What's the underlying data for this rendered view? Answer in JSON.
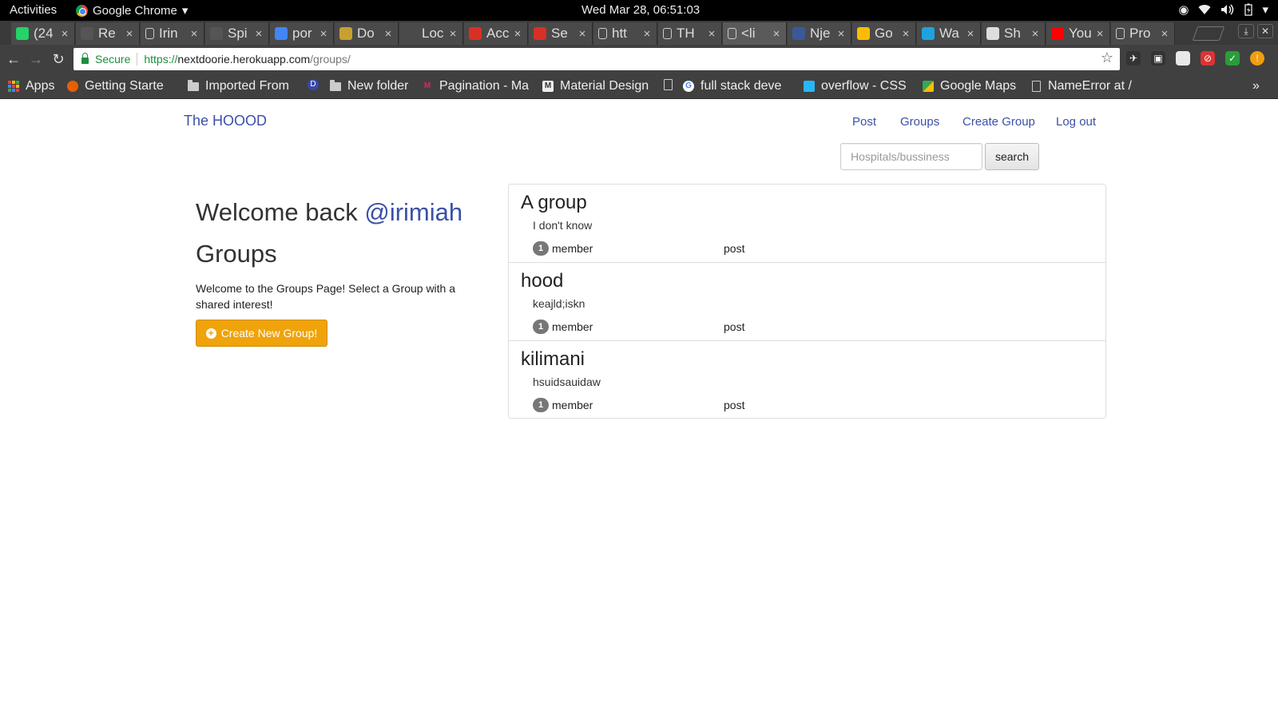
{
  "system_bar": {
    "activities": "Activities",
    "app_name": "Google Chrome",
    "app_menu_arrow": "▾",
    "clock": "Wed Mar 28, 06:51:03",
    "tray_icons": [
      "record-icon",
      "wifi-icon",
      "volume-icon",
      "battery-icon",
      "power-icon"
    ]
  },
  "tabs": [
    {
      "title": "(24",
      "icon": "whatsapp-icon",
      "color": "#25d366"
    },
    {
      "title": "Re",
      "icon": "react-icon",
      "color": "#555"
    },
    {
      "title": "Irin",
      "icon": "page-icon",
      "color": "#ccc"
    },
    {
      "title": "Spi",
      "icon": "github-icon",
      "color": "#555"
    },
    {
      "title": "por",
      "icon": "google-icon",
      "color": "#4285f4"
    },
    {
      "title": "Do",
      "icon": "shield-icon",
      "color": "#c7a030"
    },
    {
      "title": "Loc",
      "icon": "blank-icon",
      "color": "#4a4a4a"
    },
    {
      "title": "Acc",
      "icon": "gmail-icon",
      "color": "#d93025"
    },
    {
      "title": "Se",
      "icon": "gmail-icon",
      "color": "#d93025"
    },
    {
      "title": "htt",
      "icon": "page-icon",
      "color": "#ccc"
    },
    {
      "title": "TH",
      "icon": "page-icon",
      "color": "#ccc"
    },
    {
      "title": "<li",
      "icon": "page-icon",
      "color": "#ccc"
    },
    {
      "title": "Nje",
      "icon": "facebook-icon",
      "color": "#3b5998"
    },
    {
      "title": "Go",
      "icon": "keep-icon",
      "color": "#fbbc04"
    },
    {
      "title": "Wa",
      "icon": "play-icon",
      "color": "#1fa3e0"
    },
    {
      "title": "Sh",
      "icon": "terminal-icon",
      "color": "#ddd"
    },
    {
      "title": "You",
      "icon": "youtube-icon",
      "color": "#ff0000"
    },
    {
      "title": "Pro",
      "icon": "page-icon",
      "color": "#ccc"
    }
  ],
  "address_bar": {
    "secure_label": "Secure",
    "url_scheme": "https://",
    "url_host": "nextdoorie.herokuapp.com",
    "url_path": "/groups/"
  },
  "bookmarks": [
    {
      "label": "Apps",
      "kind": "apps"
    },
    {
      "label": "Getting Starte",
      "kind": "firefox"
    },
    {
      "label": "Imported From",
      "kind": "folder"
    },
    {
      "label": "",
      "kind": "d-badge"
    },
    {
      "label": "New folder",
      "kind": "folder"
    },
    {
      "label": "Pagination - Ma",
      "kind": "m-logo"
    },
    {
      "label": "Material Design",
      "kind": "material"
    },
    {
      "label": "",
      "kind": "page"
    },
    {
      "label": "full stack deve",
      "kind": "google"
    },
    {
      "label": "overflow - CSS",
      "kind": "overflow"
    },
    {
      "label": "Google Maps",
      "kind": "maps"
    },
    {
      "label": "NameError at /",
      "kind": "page"
    }
  ],
  "bookmarks_overflow": "»",
  "site": {
    "brand": "The HOOOD",
    "nav": [
      "Post",
      "Groups",
      "Create Group",
      "Log out"
    ],
    "search": {
      "placeholder": "Hospitals/bussiness",
      "button": "search"
    },
    "welcome_prefix": "Welcome back",
    "username": "@irimiah",
    "heading": "Groups",
    "intro": "Welcome to the Groups Page! Select a Group with a shared interest!",
    "create_button": "Create New Group!",
    "groups": [
      {
        "name": "A group",
        "description": "I don't know",
        "members": "1",
        "member_label": "member",
        "post_label": "post"
      },
      {
        "name": "hood",
        "description": "keajld;iskn",
        "members": "1",
        "member_label": "member",
        "post_label": "post"
      },
      {
        "name": "kilimani",
        "description": "hsuidsauidaw",
        "members": "1",
        "member_label": "member",
        "post_label": "post"
      }
    ]
  },
  "colors": {
    "link": "#3b50a8",
    "create_button": "#f0a30a",
    "badge": "#777777"
  }
}
